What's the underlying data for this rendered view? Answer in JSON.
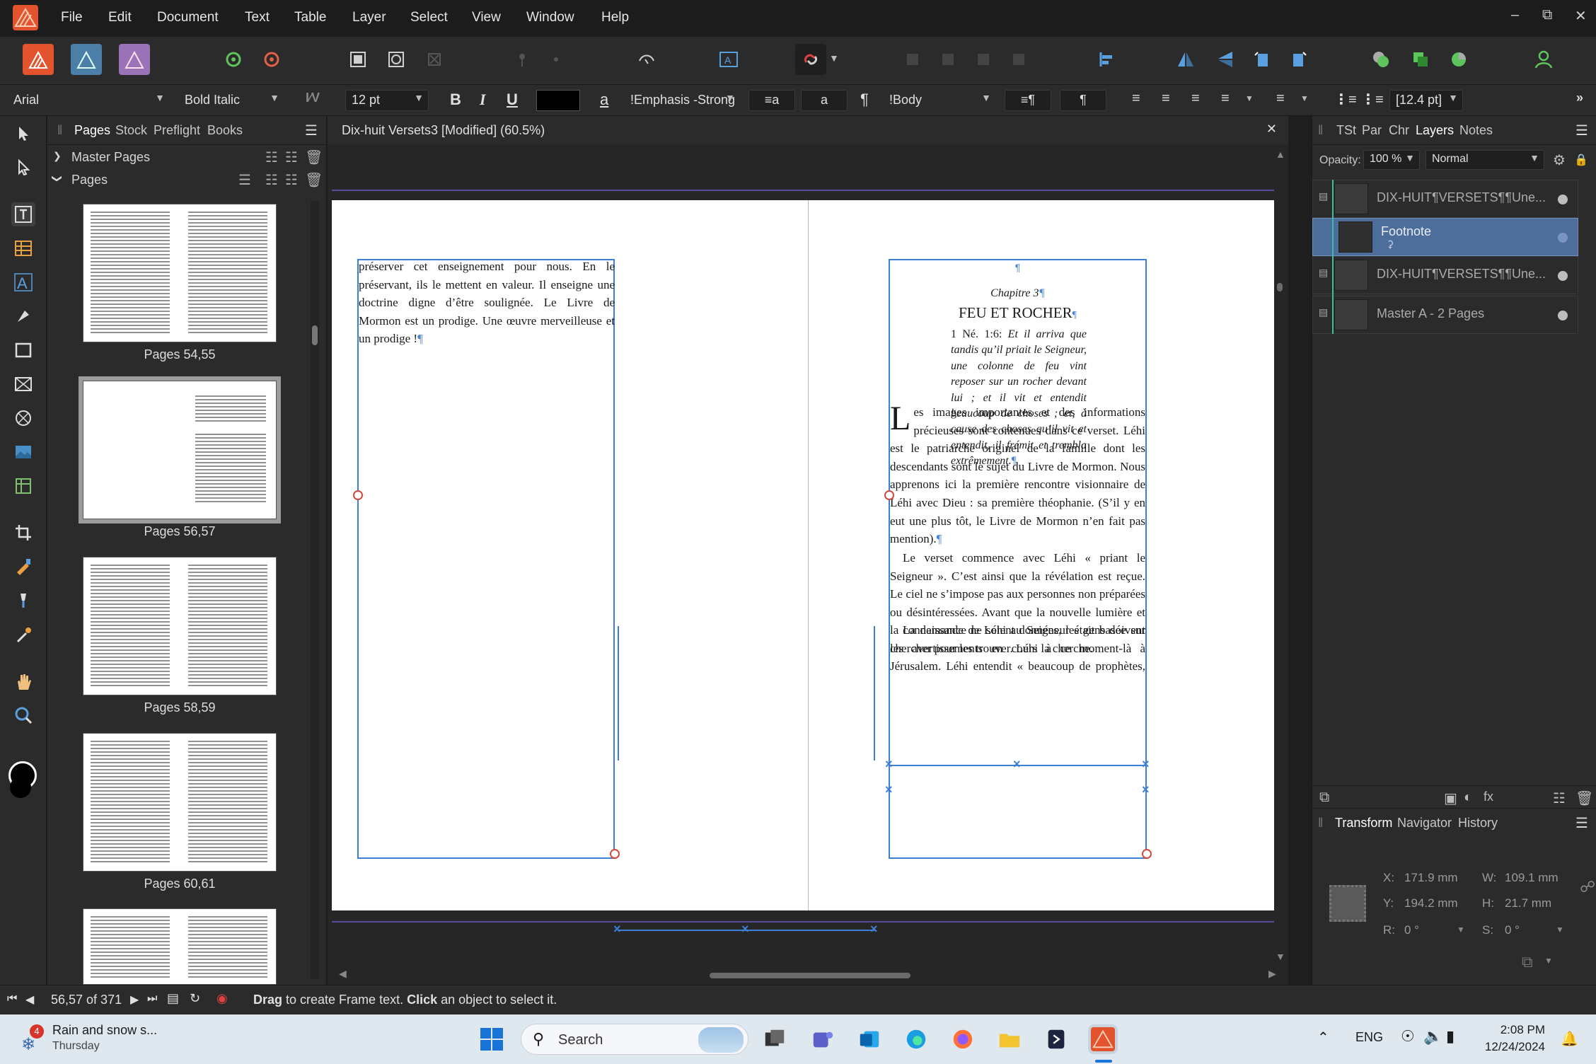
{
  "menu": {
    "items": [
      "File",
      "Edit",
      "Document",
      "Text",
      "Table",
      "Layer",
      "Select",
      "View",
      "Window",
      "Help"
    ]
  },
  "context": {
    "font": "Arial",
    "style": "Bold Italic",
    "size": "12 pt",
    "char_style": "!Emphasis -Strong",
    "para_style": "!Body",
    "leading": "[12.4 pt]",
    "bold": "B",
    "italic": "I",
    "underline": "U",
    "a": "a",
    "pilcrow": "¶",
    "text_color": "#000000"
  },
  "pages_panel": {
    "tabs": [
      "Pages",
      "Stock",
      "Preflight",
      "Books"
    ],
    "master_pages": "Master Pages",
    "pages": "Pages",
    "thumbnails": [
      "Pages 54,55",
      "Pages 56,57",
      "Pages 58,59",
      "Pages 60,61"
    ]
  },
  "document": {
    "title": "Dix-huit Versets3 [Modified] (60.5%)",
    "left_page_text": "préserver cet enseignement pour nous. En le préservant, ils le mettent en valeur. Il enseigne une doctrine digne d’être soulignée. Le Livre de Mormon est un prodige. Une œuvre merveilleuse et un prodige !",
    "chapter": "Chapitre 3",
    "heading": "FEU ET ROCHER",
    "verse_ref": "1 Né. 1:6",
    "verse_text": "Et il arriva que tandis qu’il priait le Seigneur, une colonne de feu vint reposer sur un rocher devant lui ; et il vit et entendit beaucoup de choses ; et, à cause des choses qu’il vit et entendit, il frémit et trembla extrêmement.",
    "drop_cap": "L",
    "para1": "es images importantes et des informations précieuses sont contenues dans ce verset. Léhi est le patriarche originel de la famille dont les descendants sont le sujet du Livre de Mormon. Nous apprenons ici la première rencontre visionnaire de Léhi avec Dieu : sa première théophanie. (S’il y en eut une plus tôt, le Livre de Mormon n’en fait pas mention).",
    "para2": "Le verset commence avec Léhi « priant le Seigneur ». C’est ainsi que la révélation est reçue. Le ciel ne s’impose pas aux personnes non préparées ou désintéressées. Avant que la nouvelle lumière et la connaissance ne soient données, les gens doivent chercher pour les trouver. Léhi la cherche.",
    "para3": "La demande de Léhi au Seigneur était basée sur les avertissements en cours à ce moment-là à Jérusalem. Léhi entendit « beaucoup de prophètes, prophétisant » un avertissement à Jérusalem qu’elle était sur le point d’être détruite. (1 Né. 1:4.) Ces prophètes auraient, sans aucun doute, inclus Jérémie, qui était un contemporain de Léhi. Léhi a entendu et cru ces"
  },
  "layers_panel": {
    "tabs": [
      "TSt",
      "Par",
      "Chr",
      "Layers",
      "Notes"
    ],
    "opacity_label": "Opacity:",
    "opacity": "100 %",
    "blend": "Normal",
    "layers": [
      "DIX-HUIT¶VERSETS¶¶Une...",
      "Footnote",
      "DIX-HUIT¶VERSETS¶¶Une...",
      "Master A - 2 Pages"
    ]
  },
  "transform_panel": {
    "tabs": [
      "Transform",
      "Navigator",
      "History"
    ],
    "x_label": "X:",
    "x": "171.9 mm",
    "y_label": "Y:",
    "y": "194.2 mm",
    "w_label": "W:",
    "w": "109.1 mm",
    "h_label": "H:",
    "h": "21.7 mm",
    "r_label": "R:",
    "r": "0 °",
    "s_label": "S:",
    "s": "0 °"
  },
  "status": {
    "page_counter": "56,57 of 371",
    "hint_drag": "Drag",
    "hint_1": " to create Frame text. ",
    "hint_click": "Click",
    "hint_2": " an object to select it."
  },
  "taskbar": {
    "weather_title": "Rain and snow s...",
    "weather_sub": "Thursday",
    "weather_badge": "4",
    "search": "Search",
    "lang": "ENG",
    "time": "2:08 PM",
    "date": "12/24/2024"
  },
  "colors": {
    "accent": "#3d7fd6",
    "selection": "#4d6d9a",
    "app_red": "#e2532e"
  }
}
